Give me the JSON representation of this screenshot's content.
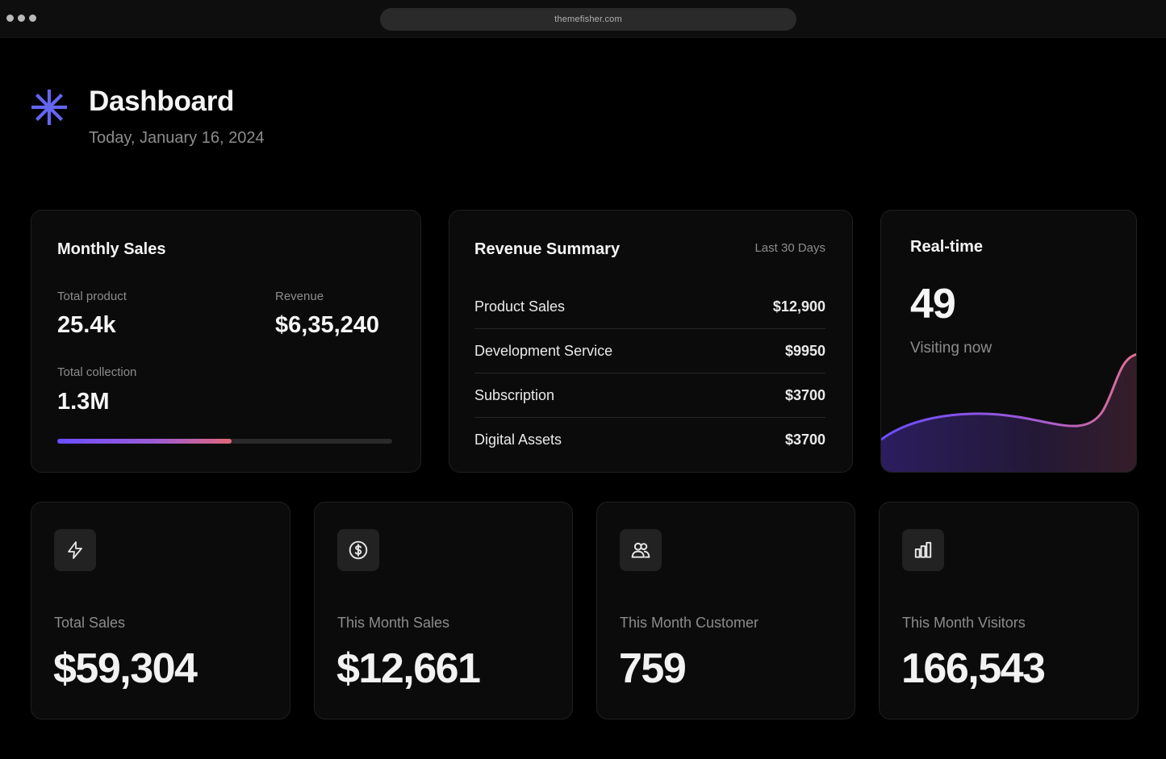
{
  "browser": {
    "url": "themefisher.com"
  },
  "header": {
    "title": "Dashboard",
    "date": "Today, January 16, 2024",
    "logo_icon": "asterisk-icon",
    "accent_color": "#6366f1"
  },
  "monthly_sales": {
    "title": "Monthly Sales",
    "total_product_label": "Total product",
    "total_product_value": "25.4k",
    "revenue_label": "Revenue",
    "revenue_value": "$6,35,240",
    "total_collection_label": "Total collection",
    "total_collection_value": "1.3M",
    "progress_fraction": 0.52
  },
  "revenue_summary": {
    "title": "Revenue Summary",
    "period": "Last 30 Days",
    "items": [
      {
        "label": "Product Sales",
        "amount": "$12,900"
      },
      {
        "label": "Development Service",
        "amount": "$9950"
      },
      {
        "label": "Subscription",
        "amount": "$3700"
      },
      {
        "label": "Digital Assets",
        "amount": "$3700"
      }
    ]
  },
  "realtime": {
    "title": "Real-time",
    "value": "49",
    "caption": "Visiting now"
  },
  "stats": [
    {
      "label": "Total Sales",
      "value": "$59,304",
      "icon": "lightning-icon"
    },
    {
      "label": "This Month Sales",
      "value": "$12,661",
      "icon": "dollar-circle-icon"
    },
    {
      "label": "This Month Customer",
      "value": "759",
      "icon": "users-icon"
    },
    {
      "label": "This Month Visitors",
      "value": "166,543",
      "icon": "bar-chart-icon"
    }
  ]
}
